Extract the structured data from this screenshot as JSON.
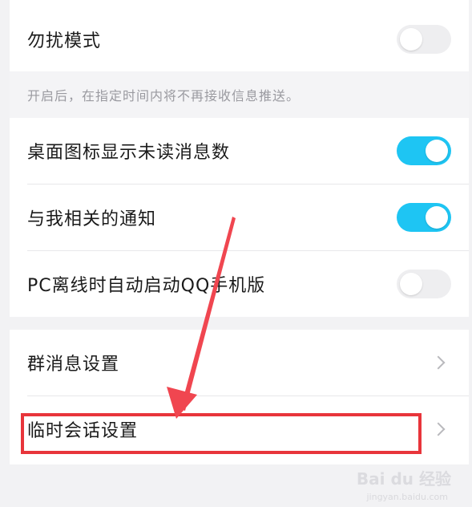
{
  "settings": {
    "dnd": {
      "label": "勿扰模式",
      "enabled": false
    },
    "dnd_hint": "开启后，在指定时间内将不再接收信息推送。",
    "toggles": [
      {
        "label": "桌面图标显示未读消息数",
        "enabled": true
      },
      {
        "label": "与我相关的通知",
        "enabled": true
      },
      {
        "label": "PC离线时自动启动QQ手机版",
        "enabled": false
      }
    ],
    "links": [
      {
        "label": "群消息设置"
      },
      {
        "label": "临时会话设置"
      }
    ]
  },
  "annotation": {
    "highlight_color": "#e8353b",
    "arrow_color": "#f04650"
  },
  "watermark": {
    "text": "Bai du 经验",
    "sub": "jingyan.baidu.com"
  },
  "colors": {
    "toggle_on": "#1ec5f3",
    "toggle_off": "#eeeef0",
    "background": "#f2f2f4"
  }
}
